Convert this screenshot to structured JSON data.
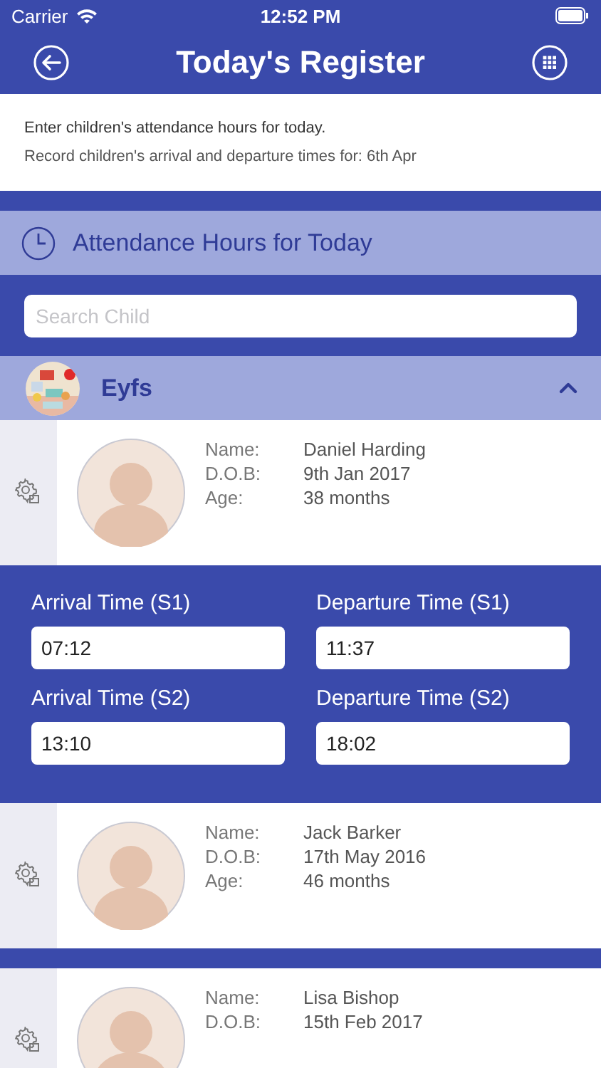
{
  "status_bar": {
    "carrier": "Carrier",
    "time": "12:52 PM"
  },
  "header": {
    "title": "Today's Register"
  },
  "intro": [
    "Enter children's attendance hours for today.",
    "Record children's arrival and departure times for: 6th Apr"
  ],
  "section": {
    "title": "Attendance Hours for Today"
  },
  "search": {
    "placeholder": "Search Child"
  },
  "group": {
    "name": "Eyfs",
    "expanded": true,
    "kind": "picture"
  },
  "children": [
    {
      "fields": [
        {
          "label": "Name:",
          "value": "Daniel Harding"
        },
        {
          "label": "D.O.B:",
          "value": "9th Jan 2017"
        },
        {
          "label": "Age:",
          "value": "38 months"
        }
      ],
      "times": [
        {
          "label": "Arrival Time (S1)",
          "value": "07:12"
        },
        {
          "label": "Departure Time (S1)",
          "value": "11:37"
        },
        {
          "label": "Arrival Time (S2)",
          "value": "13:10"
        },
        {
          "label": "Departure Time (S2)",
          "value": "18:02"
        }
      ]
    },
    {
      "fields": [
        {
          "label": "Name:",
          "value": "Jack Barker"
        },
        {
          "label": "D.O.B:",
          "value": "17th May 2016"
        },
        {
          "label": "Age:",
          "value": "46 months"
        }
      ]
    },
    {
      "fields": [
        {
          "label": "Name:",
          "value": "Lisa Bishop"
        },
        {
          "label": "D.O.B:",
          "value": "15th Feb 2017"
        }
      ]
    }
  ]
}
